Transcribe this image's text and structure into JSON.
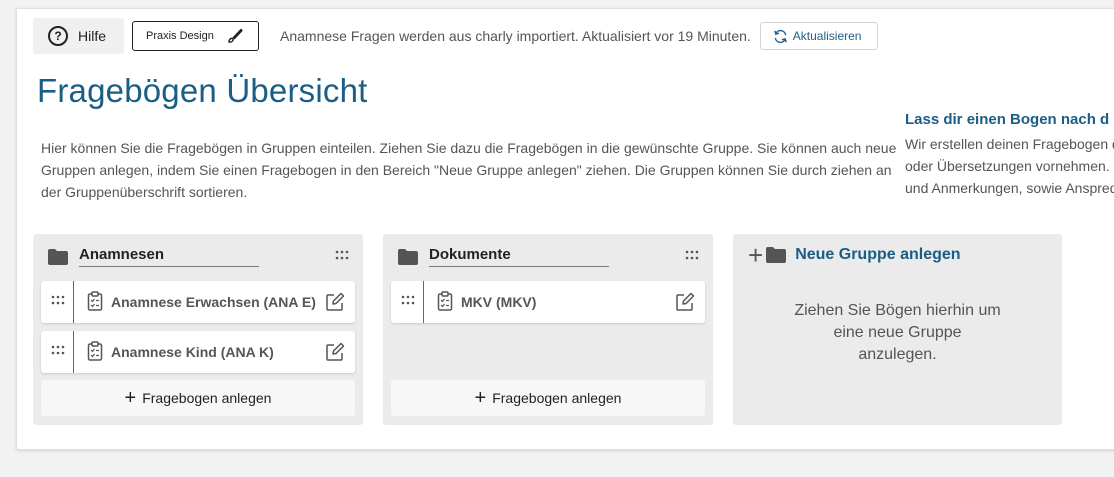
{
  "toolbar": {
    "help_label": "Hilfe",
    "design_label": "Praxis Design",
    "info_text": "Anamnese Fragen werden aus charly importiert. Aktualisiert vor 19 Minuten.",
    "refresh_label": "Aktualisieren"
  },
  "page": {
    "title": "Fragebögen Übersicht",
    "description": "Hier können Sie die Fragebögen in Gruppen einteilen. Ziehen Sie dazu die Fragebögen in die gewünschte Gruppe. Sie können auch neue Gruppen anlegen, indem Sie einen Fragebogen in den Bereich \"Neue Gruppe anlegen\" ziehen. Die Gruppen können Sie durch ziehen an der Gruppenüberschrift sortieren."
  },
  "side_panel": {
    "title": "Lass dir einen Bogen nach d",
    "lines": [
      "Wir erstellen deinen Fragebogen d",
      "oder Übersetzungen vornehmen. ",
      "und Anmerkungen, sowie Anspred"
    ]
  },
  "groups": [
    {
      "name": "Anamnesen",
      "items": [
        {
          "label": "Anamnese Erwachsen (ANA E)"
        },
        {
          "label": "Anamnese Kind (ANA K)"
        }
      ],
      "add_label": "Fragebogen anlegen"
    },
    {
      "name": "Dokumente",
      "items": [
        {
          "label": "MKV (MKV)"
        }
      ],
      "add_label": "Fragebogen anlegen"
    }
  ],
  "new_group": {
    "title": "Neue Gruppe anlegen",
    "hint": "Ziehen Sie Bögen hierhin um eine neue Gruppe anzulegen."
  },
  "colors": {
    "accent": "#1a5e86",
    "group_bg": "#ebebeb",
    "page_bg": "#f2f2f2"
  }
}
